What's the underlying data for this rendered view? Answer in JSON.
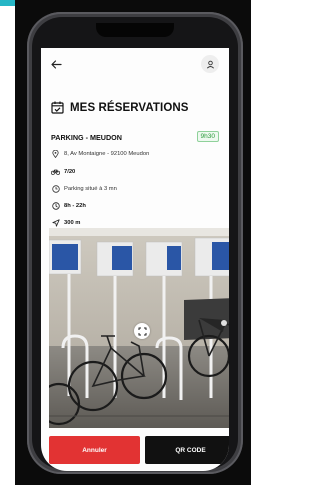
{
  "app": {
    "title": "MES RÉSERVATIONS"
  },
  "topbar": {
    "back_icon": "arrow-left-icon",
    "user_icon": "user-icon"
  },
  "reservation": {
    "parking_name": "PARKING - MEUDON",
    "time_badge": "9h30",
    "address": "8, Av Montaigne - 92100 Meudon",
    "capacity": "7/20",
    "walk_time": "Parking situé à 3 mn",
    "hours": "8h - 22h",
    "distance": "300 m"
  },
  "photo": {
    "expand_icon": "expand-icon"
  },
  "actions": {
    "cancel_label": "Annuler",
    "qr_label": "QR CODE"
  },
  "colors": {
    "accent": "#26b6c6",
    "cancel": "#e23333",
    "qr": "#111111",
    "badge_green": "#2a9a3a"
  }
}
